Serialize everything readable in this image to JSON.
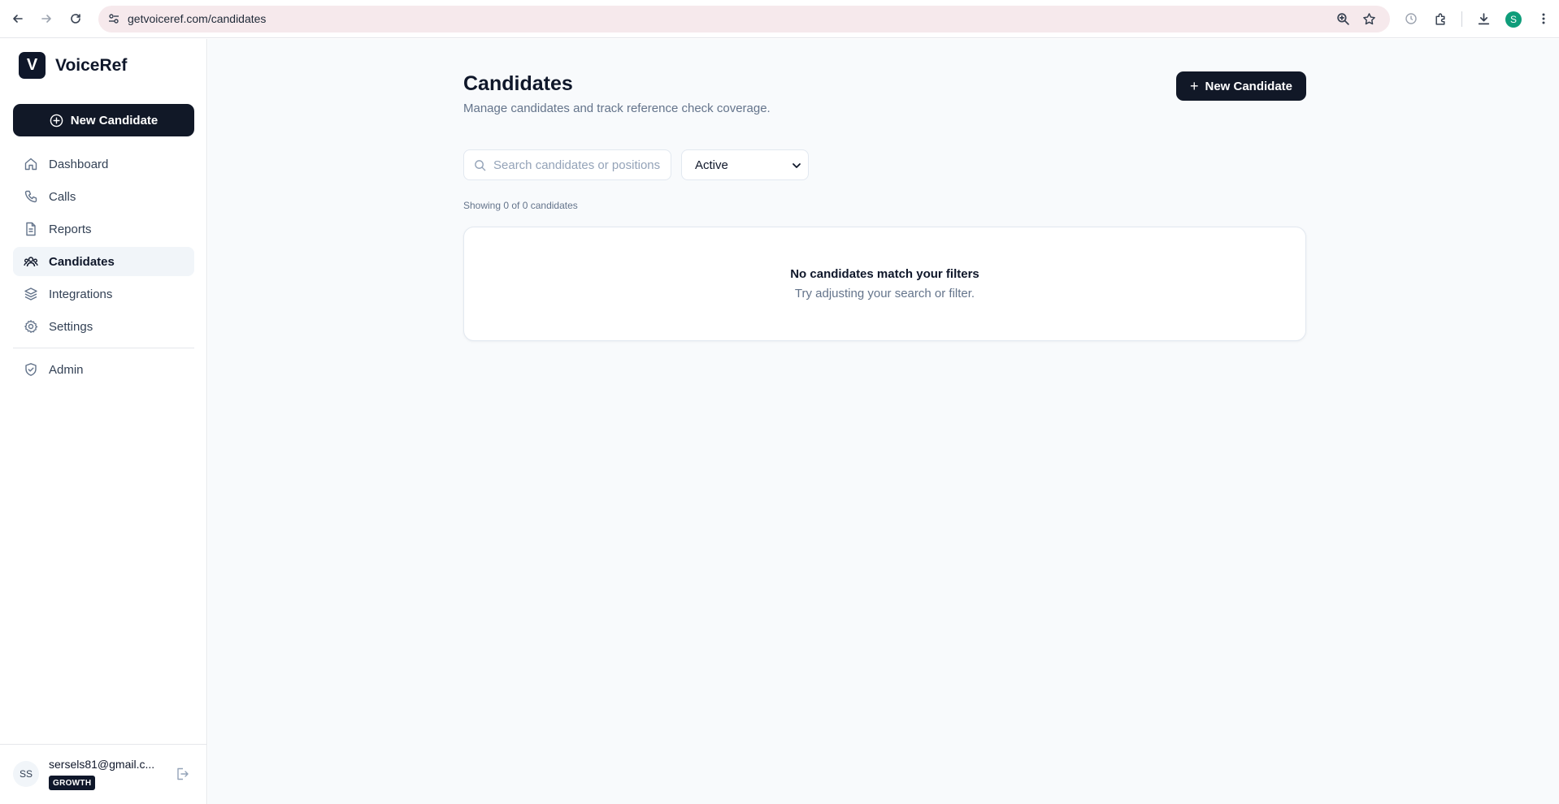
{
  "browser": {
    "url": "getvoiceref.com/candidates",
    "profile_initial": "S"
  },
  "sidebar": {
    "brand_logo": "V",
    "brand_name": "VoiceRef",
    "new_candidate_label": "New Candidate",
    "items": [
      {
        "label": "Dashboard",
        "icon": "home-icon"
      },
      {
        "label": "Calls",
        "icon": "phone-icon"
      },
      {
        "label": "Reports",
        "icon": "document-icon"
      },
      {
        "label": "Candidates",
        "icon": "users-icon",
        "active": true
      },
      {
        "label": "Integrations",
        "icon": "layers-icon"
      },
      {
        "label": "Settings",
        "icon": "gear-icon"
      }
    ],
    "admin_label": "Admin",
    "user": {
      "initials": "SS",
      "email": "sersels81@gmail.c...",
      "plan": "GROWTH"
    }
  },
  "main": {
    "title": "Candidates",
    "subtitle": "Manage candidates and track reference check coverage.",
    "new_candidate_label": "New Candidate",
    "search_placeholder": "Search candidates or positions",
    "search_value": "",
    "filter_selected": "Active",
    "showing_text": "Showing 0 of 0 candidates",
    "empty_title": "No candidates match your filters",
    "empty_subtitle": "Try adjusting your search or filter."
  },
  "colors": {
    "primary": "#111827",
    "accent_profile": "#0f9d7a",
    "omnibox": "#f6e9ec",
    "page_bg": "#f8fafc"
  }
}
